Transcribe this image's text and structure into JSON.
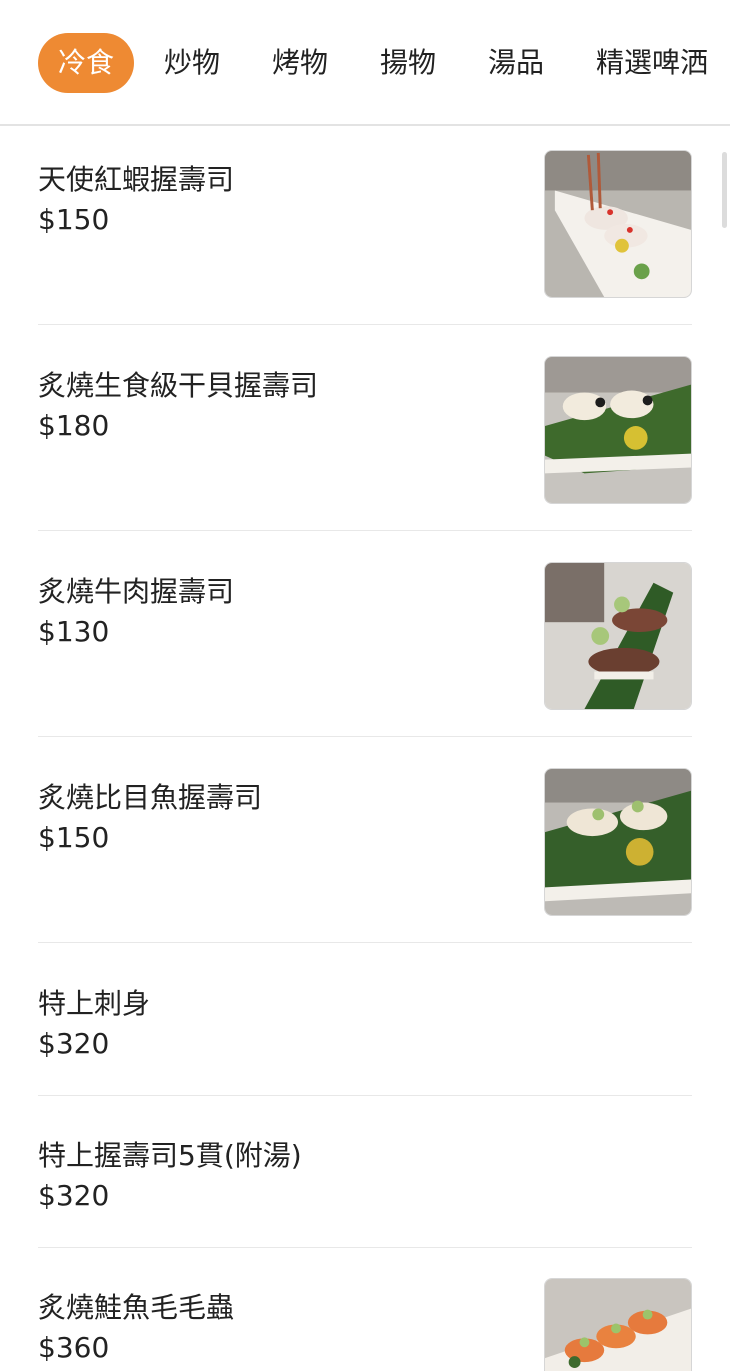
{
  "tabs": [
    {
      "label": "冷食",
      "active": true
    },
    {
      "label": "炒物"
    },
    {
      "label": "烤物"
    },
    {
      "label": "揚物"
    },
    {
      "label": "湯品"
    },
    {
      "label": "精選啤洒"
    }
  ],
  "menu": [
    {
      "name": "天使紅蝦握壽司",
      "price": "$150",
      "image": "red-shrimp-nigiri-photo"
    },
    {
      "name": "炙燒生食級干貝握壽司",
      "price": "$180",
      "image": "seared-scallop-nigiri-photo"
    },
    {
      "name": "炙燒牛肉握壽司",
      "price": "$130",
      "image": "seared-beef-nigiri-photo"
    },
    {
      "name": "炙燒比目魚握壽司",
      "price": "$150",
      "image": "seared-flounder-nigiri-photo"
    },
    {
      "name": "特上刺身",
      "price": "$320"
    },
    {
      "name": "特上握壽司5貫(附湯)",
      "price": "$320"
    },
    {
      "name": "炙燒鮭魚毛毛蟲",
      "price": "$360",
      "image": "seared-salmon-roll-photo"
    }
  ],
  "colors": {
    "accent": "#ee8a33",
    "divider": "#e8e8e8",
    "text": "#222222"
  }
}
